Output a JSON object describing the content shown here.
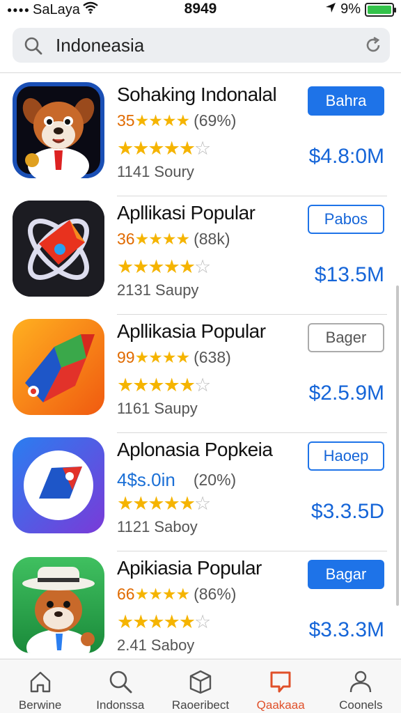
{
  "status_bar": {
    "carrier": "SaLaya",
    "time": "8949",
    "battery": "9%"
  },
  "search": {
    "value": "Indoneasia"
  },
  "apps": [
    {
      "title": "Sohaking Indonalal",
      "rating_prefix": "35",
      "rating_count": "(69%)",
      "sub_text": "1141 Soury",
      "price": "$4.8:0M",
      "button_label": "Bahra",
      "button_style": "filled",
      "star_rating": 4
    },
    {
      "title": "Apllikasi Popular",
      "rating_prefix": "36",
      "rating_count": "(88k)",
      "sub_text": "2131 Saupy",
      "price": "$13.5M",
      "button_label": "Pabos",
      "button_style": "outline",
      "star_rating": 4
    },
    {
      "title": "Apllikasia Popular",
      "rating_prefix": "99",
      "rating_count": "(638)",
      "sub_text": "1161 Saupy",
      "price": "$2.5.9M",
      "button_label": "Bager",
      "button_style": "gray",
      "star_rating": 4
    },
    {
      "title": "Aplonasia Popkeia",
      "rating_prefix": "4$s.0in",
      "rating_count": "(20%)",
      "sub_text": "1121 Saboy",
      "price": "$3.3.5D",
      "button_label": "Haoep",
      "button_style": "outline",
      "star_rating": 4
    },
    {
      "title": "Apikiasia Popular",
      "rating_prefix": "66",
      "rating_count": "(86%)",
      "sub_text": "2.41 Saboy",
      "price": "$3.3.3M",
      "button_label": "Bagar",
      "button_style": "filled",
      "star_rating": 4
    }
  ],
  "tabs": [
    {
      "label": "Berwine",
      "icon": "home-icon"
    },
    {
      "label": "Indonssa",
      "icon": "search-icon"
    },
    {
      "label": "Raoeribect",
      "icon": "box-icon"
    },
    {
      "label": "Qaakaaa",
      "icon": "chat-icon",
      "active": true
    },
    {
      "label": "Coonels",
      "icon": "person-icon"
    }
  ],
  "colors": {
    "accent": "#1e73e8",
    "price": "#1565d8",
    "rating_orange": "#e06a00",
    "star": "#f5b400",
    "active_tab": "#e0502a",
    "battery": "#33c24a"
  }
}
